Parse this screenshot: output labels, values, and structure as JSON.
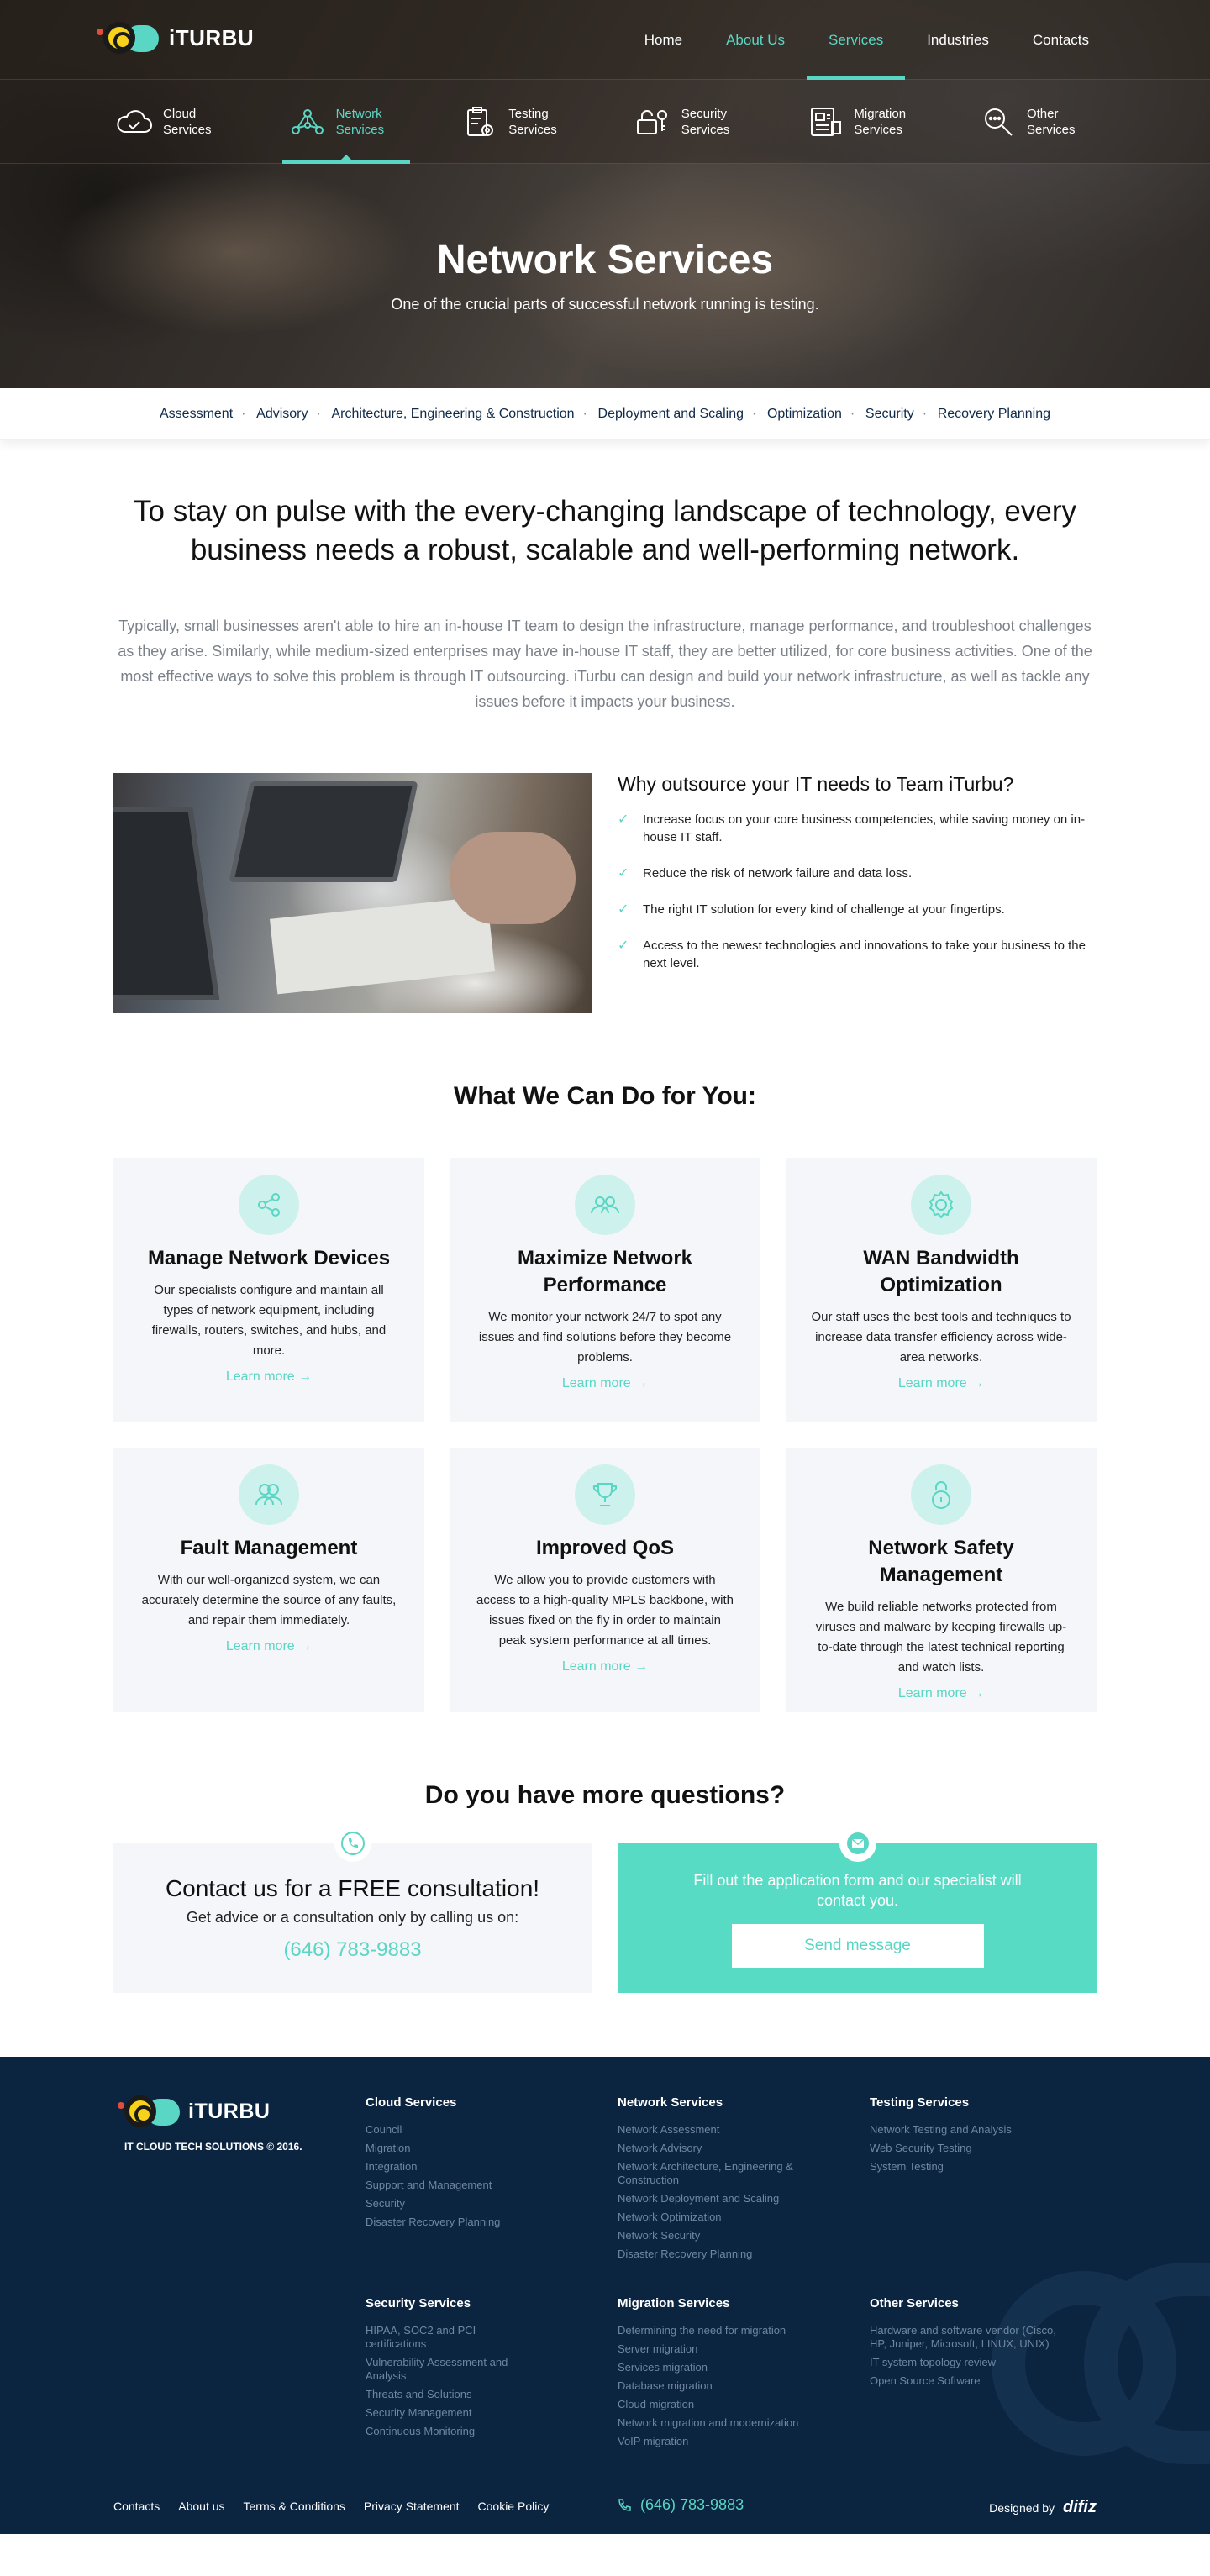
{
  "brand": {
    "name": "iTURBU",
    "copyright": "IT CLOUD TECH SOLUTIONS © 2016."
  },
  "colors": {
    "accent": "#5ad6c4",
    "footer": "#0b2440"
  },
  "nav": [
    "Home",
    "About Us",
    "Services",
    "Industries",
    "Contacts"
  ],
  "subnav": [
    {
      "label": "Cloud Services",
      "icon": "cloud-icon"
    },
    {
      "label": "Network Services",
      "icon": "network-icon"
    },
    {
      "label": "Testing Services",
      "icon": "clipboard-gear-icon"
    },
    {
      "label": "Security Services",
      "icon": "lock-key-icon"
    },
    {
      "label": "Migration Services",
      "icon": "migration-icon"
    },
    {
      "label": "Other Services",
      "icon": "magnifier-icon"
    }
  ],
  "hero": {
    "title": "Network Services",
    "subtitle": "One of the crucial parts of successful network running is testing."
  },
  "anchors": [
    "Assessment",
    "Advisory",
    "Architecture, Engineering & Construction",
    "Deployment and Scaling",
    "Optimization",
    "Security",
    "Recovery Planning"
  ],
  "intro": {
    "heading": "To stay on pulse with the every-changing landscape of technology, every business needs a robust, scalable and well-performing network.",
    "text": "Typically, small businesses  aren't able to hire an in-house IT team to design the infrastructure, manage performance, and troubleshoot challenges as they arise. Similarly, while medium-sized enterprises may have in-house IT staff, they are better utilized, for core business activities. One of the most effective ways to solve this problem is through IT outsourcing. iTurbu can design and build your network infrastructure, as well as tackle any issues before it impacts your business."
  },
  "why": {
    "title": "Why outsource your IT needs to Team iTurbu?",
    "items": [
      " Increase focus on your core business competencies, while saving money on in-house IT staff.",
      "Reduce the risk of network failure and data loss.",
      "The right IT solution for every kind of challenge at your fingertips.",
      "Access to the newest technologies and innovations to take your business to the next level."
    ]
  },
  "services": {
    "title": "What We Can Do for You:",
    "learn_more": "Learn more →",
    "cards": [
      {
        "title": "Manage Network Devices",
        "text": "Our specialists configure and maintain all types of network equipment, including firewalls, routers, switches, and hubs, and more.",
        "icon": "share-icon"
      },
      {
        "title": "Maximize Network Performance",
        "text": "We monitor your network 24/7 to spot any issues and find solutions before they become problems.",
        "icon": "group-icon"
      },
      {
        "title": "WAN Bandwidth Optimization",
        "text": "Our staff uses the best tools and techniques to increase data transfer efficiency across wide-area networks.",
        "icon": "gear-icon"
      },
      {
        "title": "Fault Management",
        "text": "With our well-organized system, we can accurately determine the source of any faults, and repair them immediately.",
        "icon": "users-icon"
      },
      {
        "title": "Improved QoS",
        "text": "We allow you to provide customers with access to a high-quality MPLS backbone, with issues fixed on the fly in order to maintain peak system performance at all times.",
        "icon": "trophy-icon"
      },
      {
        "title": "Network Safety Management",
        "text": "We build reliable networks protected from viruses and malware by keeping firewalls up-to-date through the latest technical reporting and watch lists.",
        "icon": "padlock-icon"
      }
    ]
  },
  "questions": {
    "title": "Do you have more questions?",
    "consult_title": "Contact us for a FREE consultation!",
    "consult_text": "Get advice or a consultation only by calling us on:",
    "phone": "(646) 783-9883",
    "form_text": "Fill out the application form and our specialist will contact you.",
    "send": "Send message"
  },
  "footer": {
    "columns": [
      {
        "title": "Cloud Services",
        "links": [
          "Council",
          "Migration",
          "Integration",
          "Support and Management",
          "Security",
          "Disaster Recovery Planning"
        ]
      },
      {
        "title": "Network Services",
        "links": [
          "Network Assessment",
          "Network Advisory",
          "Network Architecture, Engineering & Construction",
          "Network Deployment and Scaling",
          "Network Optimization",
          "Network Security",
          "Disaster Recovery Planning"
        ]
      },
      {
        "title": "Testing Services",
        "links": [
          "Network Testing and Analysis",
          "Web Security Testing",
          "System Testing"
        ]
      },
      {
        "title": "Security Services",
        "links": [
          "HIPAA, SOC2 and PCI certifications",
          "Vulnerability Assessment and Analysis",
          "Threats and Solutions",
          "Security Management",
          "Continuous Monitoring"
        ]
      },
      {
        "title": "Migration Services",
        "links": [
          "Determining the need for migration",
          "Server migration",
          "Services migration",
          "Database migration",
          "Cloud migration",
          "Network migration and modernization",
          "VoIP migration"
        ]
      },
      {
        "title": "Other Services",
        "links": [
          "Hardware and software vendor (Cisco, HP, Juniper, Microsoft, LINUX, UNIX)",
          "IT system topology review",
          "Open Source Software"
        ]
      }
    ],
    "bottom_links": [
      "Contacts",
      "About us",
      "Terms & Conditions",
      "Privacy Statement",
      "Cookie Policy"
    ],
    "phone": "(646) 783-9883",
    "designed_by": "Designed by",
    "designer": "difiz"
  }
}
